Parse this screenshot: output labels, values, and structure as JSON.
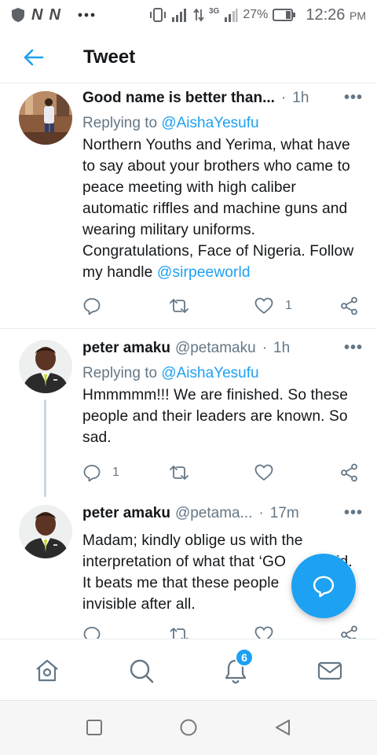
{
  "status_bar": {
    "carrier_letters": [
      "N",
      "N"
    ],
    "network": "3G",
    "battery": "27%",
    "time": "12:26",
    "ampm": "PM"
  },
  "header": {
    "title": "Tweet"
  },
  "tweets": [
    {
      "name": "Good name is better than...",
      "handle": "",
      "time": "1h",
      "reply_prefix": "Replying to",
      "reply_to": "@AishaYesufu",
      "text": "Northern Youths and Yerima, what have to say about your brothers who came to peace meeting with high caliber automatic riffles and machine guns and wearing military uniforms. Congratulations, Face of Nigeria. Follow my handle",
      "text_mention": "@sirpeeworld",
      "reply_count": "",
      "like_count": "1"
    },
    {
      "name": "peter amaku",
      "handle": "@petamaku",
      "time": "1h",
      "reply_prefix": "Replying to",
      "reply_to": "@AishaYesufu",
      "text": "Hmmmmm!!! We are finished. So these people and their leaders are known. So sad.",
      "reply_count": "1",
      "like_count": ""
    },
    {
      "name": "peter amaku",
      "handle": "@petama...",
      "time": "17m",
      "text_line1": "Madam; kindly oblige us with the",
      "text_line2": "interpretation of what that ‘GO",
      "text_line2_tail": "id.",
      "text_line3": "It beats me that these people",
      "text_line4": "invisible after all."
    }
  ],
  "bottom_nav": {
    "notification_badge": "6"
  },
  "colors": {
    "accent": "#1da1f2",
    "secondary_text": "#657786",
    "primary_text": "#14171a",
    "divider": "#e6ecf0"
  }
}
